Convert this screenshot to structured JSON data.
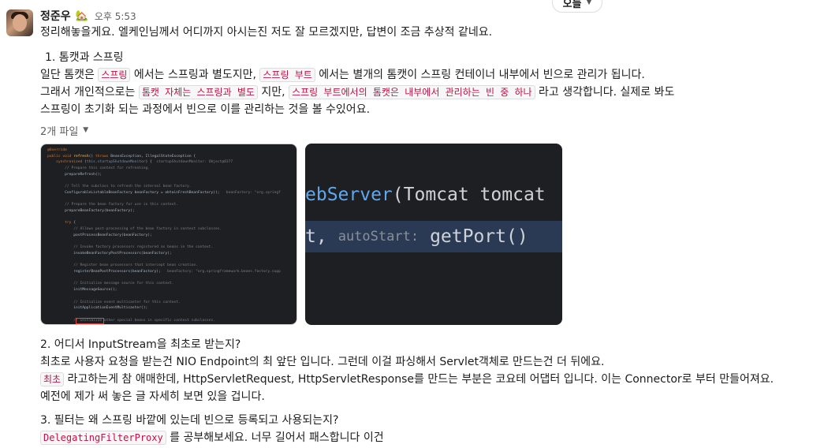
{
  "date_divider": {
    "label": "오늘"
  },
  "message": {
    "author": "정준우",
    "status_emoji": "🏡",
    "time": "오후 5:53",
    "intro": "정리해놓을게요. 엘케인님께서 어디까지 아시는진 저도 잘 모르겠지만, 답변이 조금 추상적 같네요.",
    "q1": {
      "title": "1.   톰캣과 스프링",
      "l1_a": "일단 톰캣은 ",
      "l1_code1": "스프링",
      "l1_b": " 에서는 스프링과 별도지만, ",
      "l1_code2": "스프링 부트",
      "l1_c": " 에서는 별개의 톰캣이 스프링 컨테이너 내부에서 빈으로 관리가 됩니다.",
      "l2_a": "그래서 개인적으로는 ",
      "l2_code1": "톰캣 자체는 스프링과 별도",
      "l2_b": " 지만, ",
      "l2_code2": "스프링 부트에서의 톰캣은 내부에서 관리하는 빈 중 하나",
      "l2_c": " 라고 생각합니다. 실제로 봐도",
      "l3": "스프링이 초기화 되는 과정에서 빈으로 이를 관리하는 것을 볼 수있어요."
    },
    "files_toggle": "2개 파일",
    "zoom_image": {
      "line1_prefix": "ebServer",
      "line1_rest": "(Tomcat tomcat",
      "line2_prefix": "t,",
      "line2_hint": "autoStart:",
      "line2_rest": "getPort()"
    },
    "q2": {
      "title": "2. 어디서 InputStream을 최초로 받는지?",
      "l1": "최초로 사용자 요청을 받는건 NIO Endpoint의 최 앞단 입니다. 그런데 이걸 파싱해서 Servlet객체로 만드는건 더 뒤에요.",
      "l2_code": "최초",
      "l2_rest": " 라고하는게 참 애매한데, HttpServletRequest, HttpServletResponse를 만드는 부분은 코요테 어댑터 입니다. 이는 Connector로 부터 만들어져요.",
      "l3": "예전에 제가 써 놓은 글 자세히 보면 있을 겁니다."
    },
    "q3": {
      "title": "3. 필터는 왜 스프링 바깥에 있는데 빈으로 등록되고 사용되는지?",
      "l1_code": "DelegatingFilterProxy",
      "l1_rest": " 를 공부해보세요. 너무 길어서 패스합니다 이건"
    }
  }
}
